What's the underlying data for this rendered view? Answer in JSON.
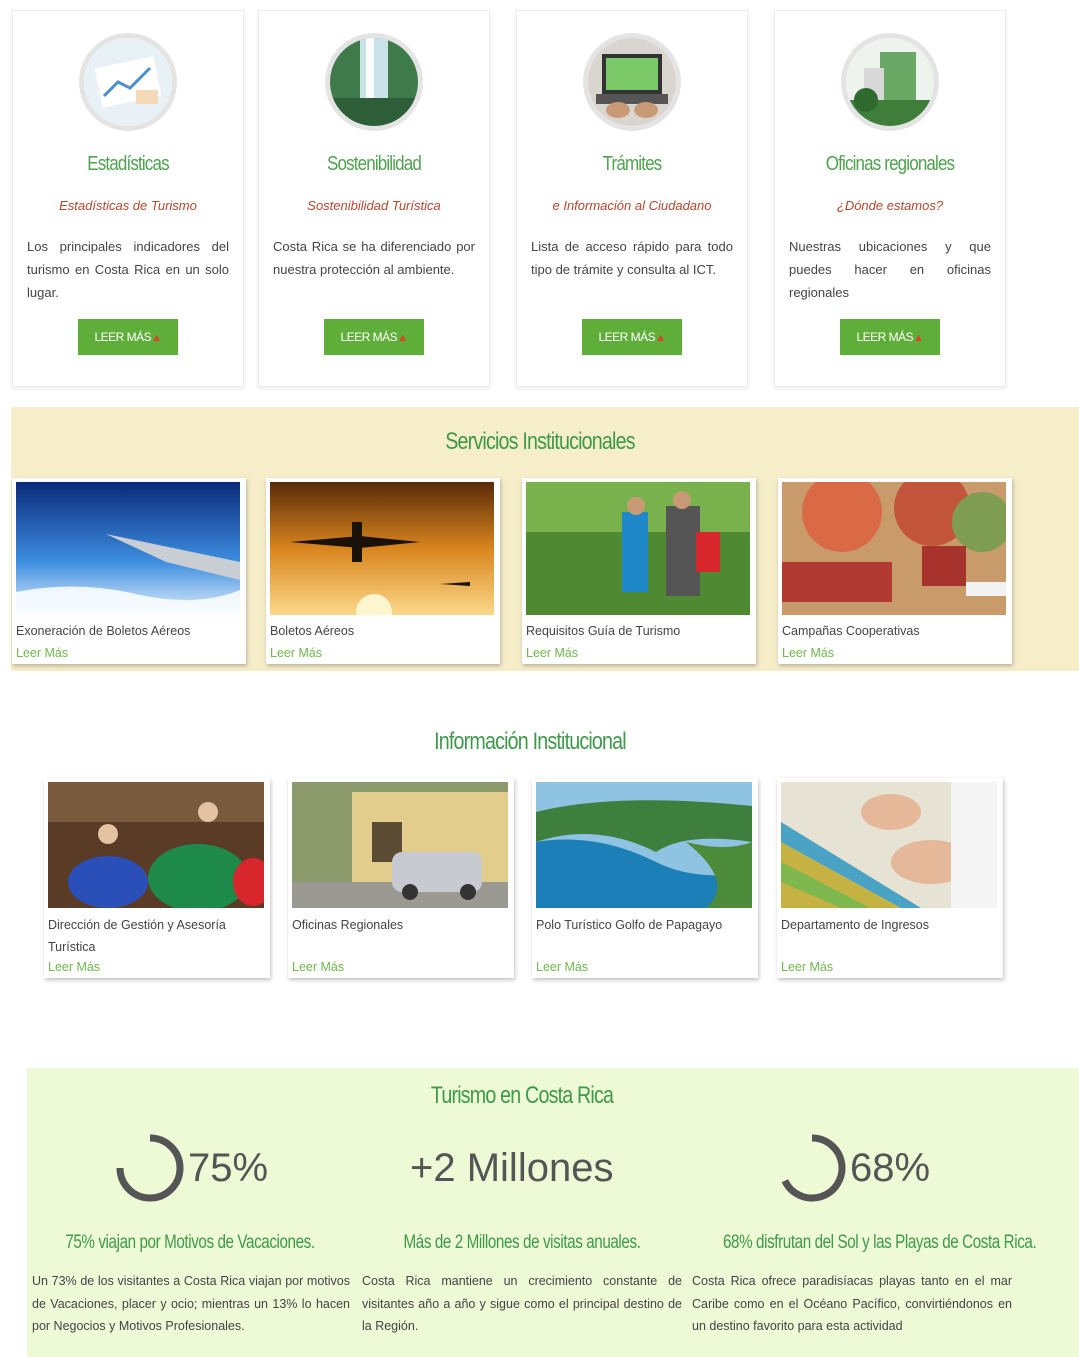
{
  "cards": [
    {
      "title": "Estadísticas",
      "subtitle": "Estadísticas de Turismo",
      "desc": "Los principales indicadores del turismo en Costa Rica en un solo lugar.",
      "button": "LEER MÁS",
      "image": "statistics-photo"
    },
    {
      "title": "Sostenibilidad",
      "subtitle": "Sostenibilidad Turística",
      "desc": "Costa Rica se ha diferenciado por nuestra protección al ambiente.",
      "button": "LEER MÁS",
      "image": "waterfall-photo"
    },
    {
      "title": "Trámites",
      "subtitle": "e Información al Ciudadano",
      "desc": "Lista de acceso rápido para todo tipo de trámite y consulta al ICT.",
      "button": "LEER MÁS",
      "image": "laptop-photo"
    },
    {
      "title": "Oficinas regionales",
      "subtitle": "¿Dónde estamos?",
      "desc": "Nuestras ubicaciones y que puedes hacer en oficinas regionales",
      "button": "LEER MÁS",
      "image": "building-photo"
    }
  ],
  "servicios": {
    "title": "Servicios Institucionales",
    "items": [
      {
        "caption": "Exoneración de Boletos Aéreos",
        "link": "Leer Más"
      },
      {
        "caption": "Boletos Aéreos",
        "link": "Leer Más"
      },
      {
        "caption": "Requisitos Guía de Turismo",
        "link": "Leer Más"
      },
      {
        "caption": "Campañas Cooperativas",
        "link": "Leer Más"
      }
    ]
  },
  "informacion": {
    "title": "Información Institucional",
    "items": [
      {
        "caption": "Dirección de Gestión y Asesoría Turística",
        "link": "Leer Más"
      },
      {
        "caption": "Oficinas Regionales",
        "link": "Leer Más"
      },
      {
        "caption": "Polo Turístico Golfo de Papagayo",
        "link": "Leer Más"
      },
      {
        "caption": "Departamento de Ingresos",
        "link": "Leer Más"
      }
    ]
  },
  "turismo": {
    "title": "Turismo en Costa Rica",
    "stats": [
      {
        "value": "75%",
        "fraction": 0.75,
        "heading": "75% viajan por Motivos de Vacaciones.",
        "text": "Un 73% de los visitantes a Costa Rica viajan por motivos de Vacaciones, placer y ocio; mientras un 13% lo hacen por Negocios y Motivos Profesionales."
      },
      {
        "value": "+2 Millones",
        "heading": "Más de 2 Millones de visitas anuales.",
        "text": "Costa Rica mantiene un crecimiento constante de visitantes año a año y sigue como el principal destino de la Región."
      },
      {
        "value": "68%",
        "fraction": 0.68,
        "heading": "68% disfrutan del Sol y las Playas de Costa Rica.",
        "text": "Costa Rica ofrece paradisíacas playas tanto en el mar Caribe como en el Océano Pacífico, convirtiéndonos en un destino favorito para esta actividad"
      }
    ]
  },
  "colors": {
    "green_title": "#3e9a4a",
    "button": "#5fae3a",
    "subtitle": "#b5472a",
    "servicios_bg": "#f6edc9",
    "turismo_bg": "#eef9d6"
  }
}
